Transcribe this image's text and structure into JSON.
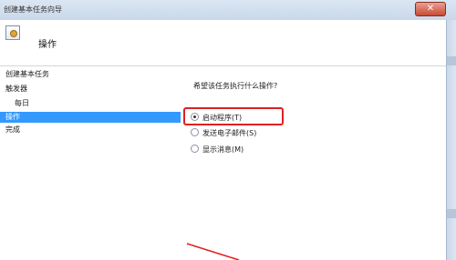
{
  "window": {
    "title": "创建基本任务向导",
    "close_label": "✕"
  },
  "header": {
    "title": "操作"
  },
  "sidebar": {
    "items": [
      {
        "label": "创建基本任务"
      },
      {
        "label": "触发器"
      },
      {
        "label": "每日"
      },
      {
        "label": "操作"
      },
      {
        "label": "完成"
      }
    ]
  },
  "main": {
    "question": "希望该任务执行什么操作?",
    "options": [
      {
        "label": "启动程序(T)",
        "selected": true
      },
      {
        "label": "发送电子邮件(S)",
        "selected": false
      },
      {
        "label": "显示消息(M)",
        "selected": false
      }
    ]
  },
  "annotation": {
    "highlight_color": "#e02020"
  }
}
